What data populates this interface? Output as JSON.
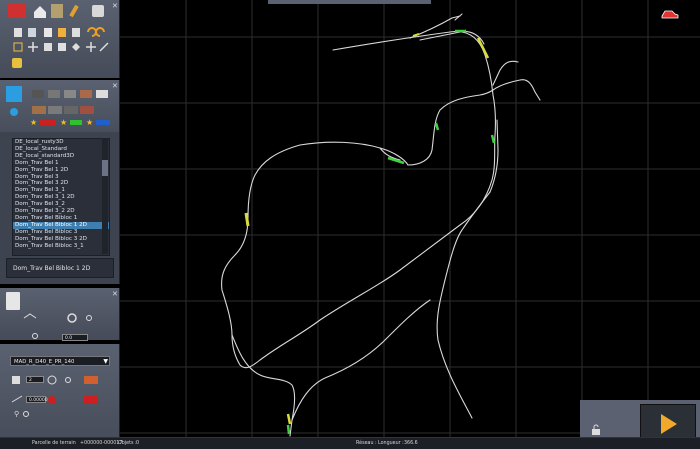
{
  "app": {
    "panel_list": {
      "items": [
        "DE_local_rusty3D",
        "DE_local_Standard",
        "DE_local_standard3D",
        "Dom_Trav Bel 1",
        "Dom_Trav Bel 1 2D",
        "Dom_Trav Bel 3",
        "Dom_Trav Bel 3 2D",
        "Dom_Trav Bel 3_1",
        "Dom_Trav Bel 3_1 2D",
        "Dom_Trav Bel 3_2",
        "Dom_Trav Bel 3_2 2D",
        "Dom_Trav Bel Bibloc 1",
        "Dom_Trav Bel Bibloc 1 2D",
        "Dom_Trav Bel Bibloc 3",
        "Dom_Trav Bel Bibloc 3 2D",
        "Dom_Trav Bel Bibloc 3_1"
      ],
      "selected_index": 12,
      "selected_value": "Dom_Trav Bel Bibloc 1 2D"
    },
    "props": {
      "height_value": "0.0",
      "track_dropdown": "MAD_R_D40_E_PR_140",
      "field_a": "2",
      "field_b": "0.00000"
    },
    "status": {
      "tile_label": "Parcelle de terrain",
      "tile_value": "+000000-000017",
      "objects_label": "Objets :",
      "objects_value": "0",
      "network_label": "Réseau :",
      "length_label": "Longueur :",
      "length_value": "366.6"
    },
    "colors": {
      "panel": "#5a6170",
      "accent_green": "#3fd23f",
      "accent_yellow": "#d9dc3a",
      "selection": "#3f7fb0",
      "play": "#f1a92b"
    }
  }
}
